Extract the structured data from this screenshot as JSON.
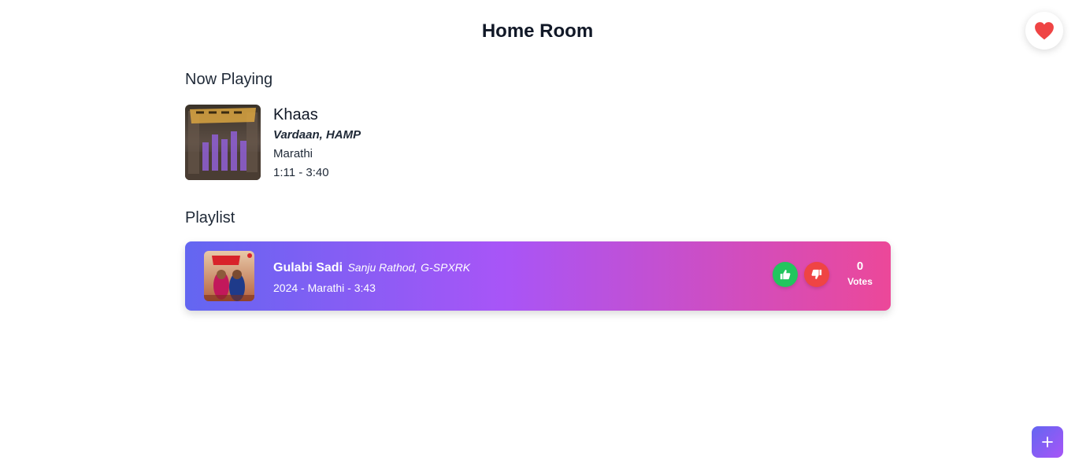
{
  "room": {
    "title": "Home Room"
  },
  "favorite": {
    "icon": "heart-icon",
    "color": "#ef4444"
  },
  "now_playing": {
    "heading": "Now Playing",
    "title": "Khaas",
    "artist": "Vardaan, HAMP",
    "language": "Marathi",
    "progress": "1:11 - 3:40",
    "cover_icon": "album-art"
  },
  "playlist": {
    "heading": "Playlist",
    "items": [
      {
        "title": "Gulabi Sadi",
        "artist": "Sanju Rathod, G-SPXRK",
        "meta": "2024 - Marathi - 3:43",
        "votes": "0",
        "votes_label": "Votes",
        "upvote_icon": "thumbs-up-icon",
        "downvote_icon": "thumbs-down-icon"
      }
    ]
  },
  "add_button": {
    "icon": "plus-icon",
    "label": "+"
  },
  "colors": {
    "gradient_start": "#6366f1",
    "gradient_mid": "#a855f7",
    "gradient_end": "#ec4899",
    "upvote": "#22c55e",
    "downvote": "#ef4444"
  }
}
